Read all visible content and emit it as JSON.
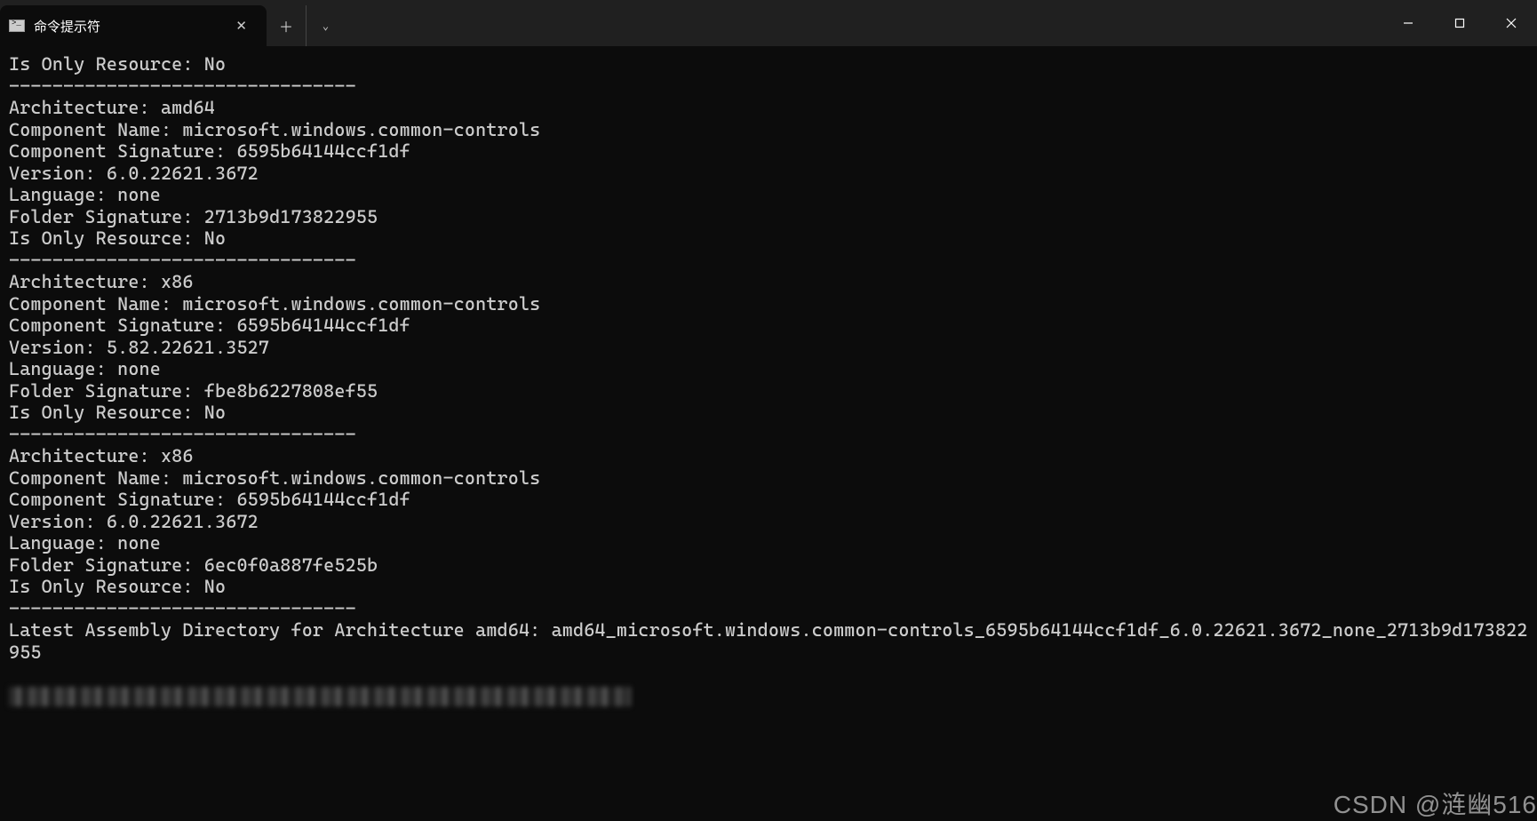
{
  "titlebar": {
    "tab_title": "命令提示符",
    "close_glyph": "✕",
    "new_tab_glyph": "＋",
    "dropdown_glyph": "⌄",
    "minimize_title": "Minimize",
    "maximize_title": "Maximize",
    "close_title": "Close"
  },
  "terminal": {
    "block0_only_resource": "Is Only Resource: No",
    "divider": "--------------------------------",
    "block1": {
      "arch": "Architecture: amd64",
      "comp_name": "Component Name: microsoft.windows.common-controls",
      "comp_sig": "Component Signature: 6595b64144ccf1df",
      "version": "Version: 6.0.22621.3672",
      "language": "Language: none",
      "folder_sig": "Folder Signature: 2713b9d173822955",
      "only_resource": "Is Only Resource: No"
    },
    "block2": {
      "arch": "Architecture: x86",
      "comp_name": "Component Name: microsoft.windows.common-controls",
      "comp_sig": "Component Signature: 6595b64144ccf1df",
      "version": "Version: 5.82.22621.3527",
      "language": "Language: none",
      "folder_sig": "Folder Signature: fbe8b6227808ef55",
      "only_resource": "Is Only Resource: No"
    },
    "block3": {
      "arch": "Architecture: x86",
      "comp_name": "Component Name: microsoft.windows.common-controls",
      "comp_sig": "Component Signature: 6595b64144ccf1df",
      "version": "Version: 6.0.22621.3672",
      "language": "Language: none",
      "folder_sig": "Folder Signature: 6ec0f0a887fe525b",
      "only_resource": "Is Only Resource: No"
    },
    "latest_assembly": "Latest Assembly Directory for Architecture amd64: amd64_microsoft.windows.common-controls_6595b64144ccf1df_6.0.22621.3672_none_2713b9d173822955",
    "prompt_prefix": ""
  },
  "watermark": "CSDN @涟幽516"
}
